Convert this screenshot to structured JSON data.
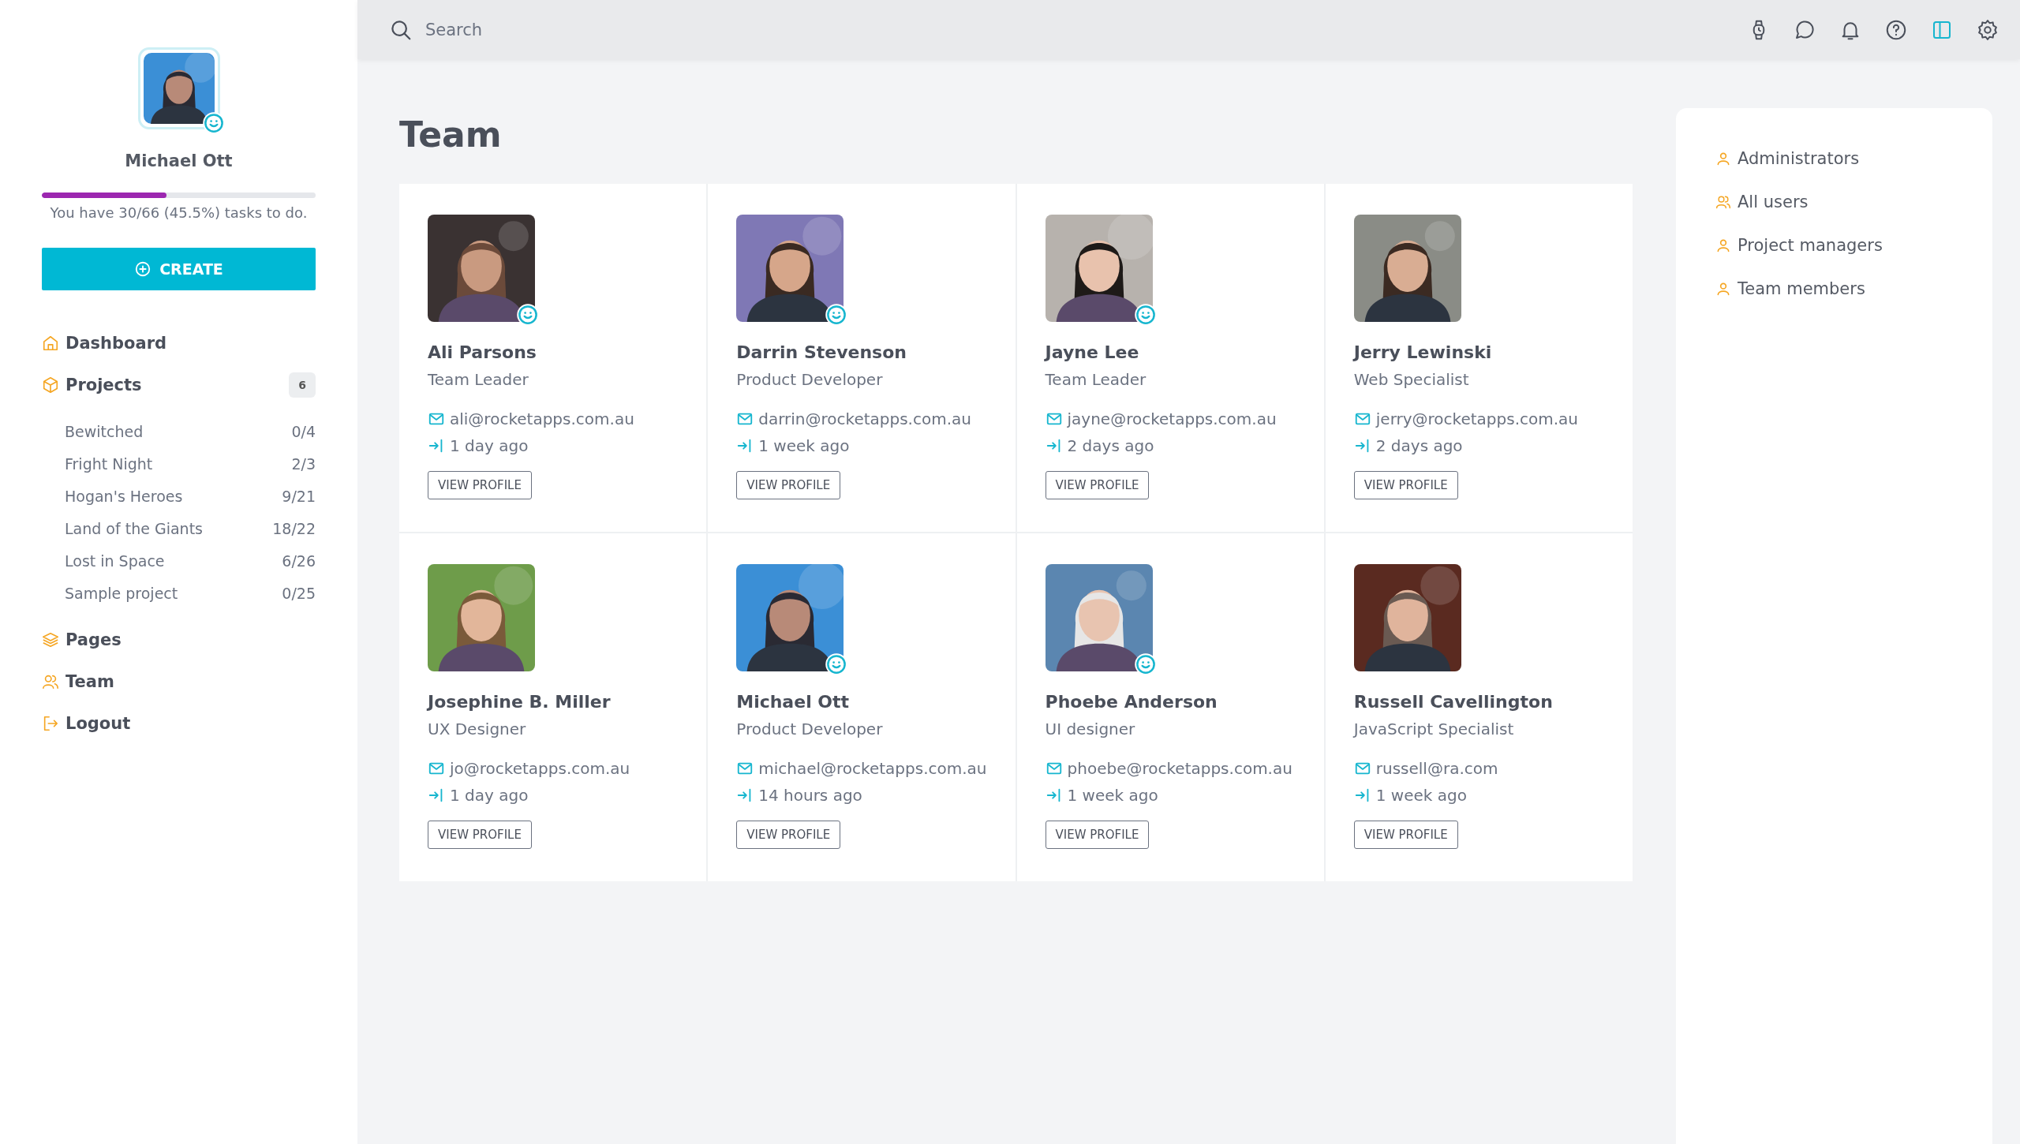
{
  "sidebar": {
    "user": {
      "name": "Michael Ott",
      "online": true
    },
    "progress": {
      "level": 0.455,
      "text": "You have 30/66 (45.5%) tasks to do."
    },
    "create_button": "CREATE",
    "nav": [
      {
        "kind": "home",
        "label": "Dashboard"
      },
      {
        "kind": "box",
        "label": "Projects",
        "badge": "6",
        "children": [
          {
            "label": "Bewitched",
            "count": "0/4"
          },
          {
            "label": "Fright Night",
            "count": "2/3"
          },
          {
            "label": "Hogan's Heroes",
            "count": "9/21"
          },
          {
            "label": "Land of the Giants",
            "count": "18/22"
          },
          {
            "label": "Lost in Space",
            "count": "6/26"
          },
          {
            "label": "Sample project",
            "count": "0/25"
          }
        ]
      },
      {
        "kind": "layers",
        "label": "Pages"
      },
      {
        "kind": "users",
        "label": "Team"
      },
      {
        "kind": "logout",
        "label": "Logout"
      }
    ]
  },
  "topbar": {
    "search": {
      "placeholder": "Search"
    },
    "icons": [
      {
        "kind": "watch",
        "selected": false
      },
      {
        "kind": "chat",
        "selected": false
      },
      {
        "kind": "bell",
        "selected": false
      },
      {
        "kind": "help",
        "selected": false
      },
      {
        "kind": "layout",
        "selected": true
      },
      {
        "kind": "gear",
        "selected": false
      }
    ]
  },
  "page_title": "Team",
  "members": [
    {
      "name": "Ali Parsons",
      "role": "Team Leader",
      "email": "ali@rocketapps.com.au",
      "last_seen": "1 day ago",
      "online": true,
      "button": "VIEW PROFILE"
    },
    {
      "name": "Darrin Stevenson",
      "role": "Product Developer",
      "email": "darrin@rocketapps.com.au",
      "last_seen": "1 week ago",
      "online": true,
      "button": "VIEW PROFILE"
    },
    {
      "name": "Jayne Lee",
      "role": "Team Leader",
      "email": "jayne@rocketapps.com.au",
      "last_seen": "2 days ago",
      "online": true,
      "button": "VIEW PROFILE"
    },
    {
      "name": "Jerry Lewinski",
      "role": "Web Specialist",
      "email": "jerry@rocketapps.com.au",
      "last_seen": "2 days ago",
      "online": false,
      "button": "VIEW PROFILE"
    },
    {
      "name": "Josephine B. Miller",
      "role": "UX Designer",
      "email": "jo@rocketapps.com.au",
      "last_seen": "1 day ago",
      "online": false,
      "button": "VIEW PROFILE"
    },
    {
      "name": "Michael Ott",
      "role": "Product Developer",
      "email": "michael@rocketapps.com.au",
      "last_seen": "14 hours ago",
      "online": true,
      "button": "VIEW PROFILE"
    },
    {
      "name": "Phoebe Anderson",
      "role": "UI designer",
      "email": "phoebe@rocketapps.com.au",
      "last_seen": "1 week ago",
      "online": true,
      "button": "VIEW PROFILE"
    },
    {
      "name": "Russell Cavellington",
      "role": "JavaScript Specialist",
      "email": "russell@ra.com",
      "last_seen": "1 week ago",
      "online": false,
      "button": "VIEW PROFILE"
    }
  ],
  "filters": [
    {
      "kind": "user",
      "label": "Administrators"
    },
    {
      "kind": "users",
      "label": "All users"
    },
    {
      "kind": "user",
      "label": "Project managers"
    },
    {
      "kind": "user",
      "label": "Team members"
    }
  ]
}
